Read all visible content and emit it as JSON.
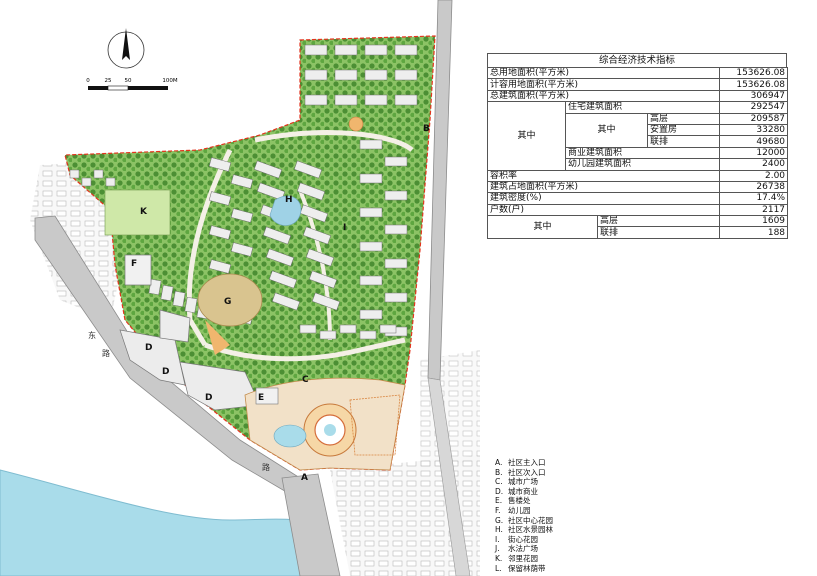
{
  "compass": {
    "north_icon": "north-arrow-icon"
  },
  "scale_bar": {
    "ticks": [
      "0",
      "25",
      "50",
      "100M"
    ]
  },
  "road_labels": {
    "left_a": "东",
    "left_b": "路",
    "bottom": "路"
  },
  "zone_labels": {
    "A": "A",
    "B": "B",
    "C": "C",
    "D1": "D",
    "D2": "D",
    "D3": "D",
    "E": "E",
    "F": "F",
    "G": "G",
    "H": "H",
    "I": "I",
    "K": "K"
  },
  "indicators": {
    "title": "综合经济技术指标",
    "rows": {
      "total_land": {
        "label": "总用地面积(平方米)",
        "value": "153626.08"
      },
      "calc_land": {
        "label": "计容用地面积(平方米)",
        "value": "153626.08"
      },
      "total_floor": {
        "label": "总建筑面积(平方米)",
        "value": "306947"
      },
      "among1": "其中",
      "residential": {
        "label": "住宅建筑面积",
        "value": "292547"
      },
      "among_res": "其中",
      "highrise": {
        "label": "高层",
        "value": "209587"
      },
      "resettle": {
        "label": "安置房",
        "value": "33280"
      },
      "row_house": {
        "label": "联排",
        "value": "49680"
      },
      "commercial": {
        "label": "商业建筑面积",
        "value": "12000"
      },
      "kindergarten": {
        "label": "幼儿园建筑面积",
        "value": "2400"
      },
      "far": {
        "label": "容积率",
        "value": "2.00"
      },
      "footprint": {
        "label": "建筑占地面积(平方米)",
        "value": "26738"
      },
      "density": {
        "label": "建筑密度(%)",
        "value": "17.4%"
      },
      "households": {
        "label": "户数(户)",
        "value": "2117"
      },
      "among2": "其中",
      "hh_highrise": {
        "label": "高层",
        "value": "1609"
      },
      "hh_row": {
        "label": "联排",
        "value": "188"
      }
    }
  },
  "legend": [
    {
      "key": "A.",
      "text": "社区主入口"
    },
    {
      "key": "B.",
      "text": "社区次入口"
    },
    {
      "key": "C.",
      "text": "城市广场"
    },
    {
      "key": "D.",
      "text": "城市商业"
    },
    {
      "key": "E.",
      "text": "售楼处"
    },
    {
      "key": "F.",
      "text": "幼儿园"
    },
    {
      "key": "G.",
      "text": "社区中心花园"
    },
    {
      "key": "H.",
      "text": "社区水景园林"
    },
    {
      "key": "I.",
      "text": "街心花园"
    },
    {
      "key": "J.",
      "text": "水法广场"
    },
    {
      "key": "K.",
      "text": "邻里花园"
    },
    {
      "key": "L.",
      "text": "保留林荫带"
    }
  ],
  "colors": {
    "river": "#a9dcea",
    "road": "#c9c9c9",
    "green": "#7fb85a",
    "dark_green": "#3f7d2e",
    "building": "#ececec",
    "boundary": "#e3341e",
    "plaza": "#e8a76a"
  }
}
